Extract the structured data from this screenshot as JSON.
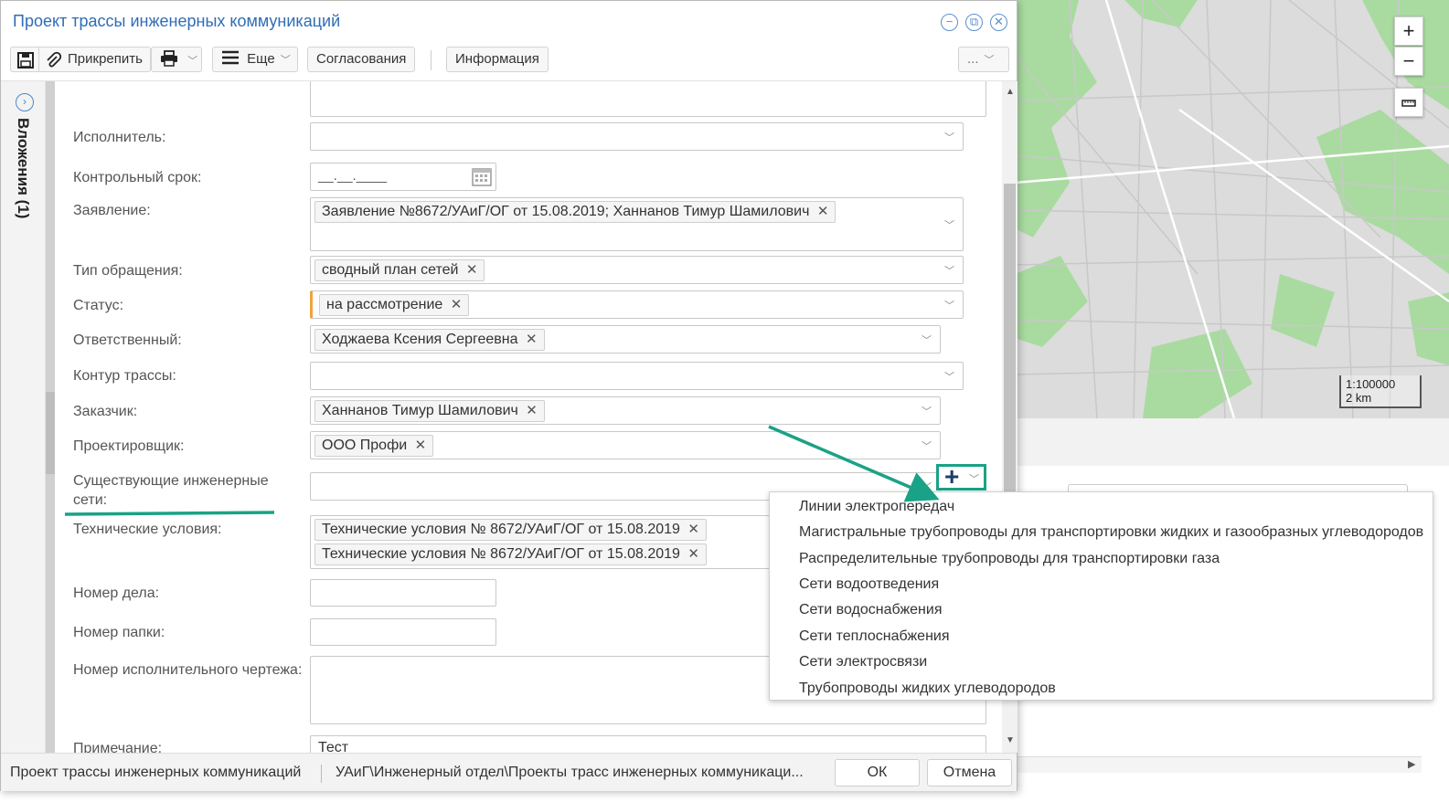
{
  "window": {
    "title": "Проект трассы инженерных коммуникаций"
  },
  "toolbar": {
    "attach_label": "Прикрепить",
    "more_label": "Еще",
    "approvals_label": "Согласования",
    "info_label": "Информация",
    "ellipsis_label": "..."
  },
  "sidebar": {
    "attachments_label": "Вложения (1)"
  },
  "form": {
    "executor": {
      "label": "Исполнитель:"
    },
    "deadline": {
      "label": "Контрольный срок:",
      "placeholder": "__.__.____"
    },
    "statement": {
      "label": "Заявление:",
      "tags": [
        "Заявление №8672/УАиГ/ОГ от 15.08.2019; Ханнанов Тимур Шамилович"
      ]
    },
    "request_type": {
      "label": "Тип обращения:",
      "tags": [
        "сводный план сетей"
      ]
    },
    "status": {
      "label": "Статус:",
      "tags": [
        "на рассмотрение"
      ]
    },
    "responsible": {
      "label": "Ответственный:",
      "tags": [
        "Ходжаева Ксения Сергеевна"
      ]
    },
    "route_contour": {
      "label": "Контур трассы:"
    },
    "customer": {
      "label": "Заказчик:",
      "tags": [
        "Ханнанов Тимур Шамилович"
      ]
    },
    "designer": {
      "label": "Проектировщик:",
      "tags": [
        "ООО Профи"
      ]
    },
    "existing_networks": {
      "label_line1": "Существующие инженерные",
      "label_line2": "сети:"
    },
    "tech_conditions": {
      "label": "Технические условия:",
      "tags": [
        "Технические условия № 8672/УАиГ/ОГ от 15.08.2019",
        "Технические условия № 8672/УАиГ/ОГ от 15.08.2019"
      ]
    },
    "case_number": {
      "label": "Номер дела:"
    },
    "folder_number": {
      "label": "Номер папки:"
    },
    "drawing_number": {
      "label": "Номер исполнительного чертежа:"
    },
    "note": {
      "label": "Примечание:",
      "value": "Тест"
    }
  },
  "dropdown": {
    "items": [
      "Линии электропередач",
      "Магистральные трубопроводы для транспортировки жидких и газообразных углеводородов",
      "Распределительные трубопроводы для транспортировки газа",
      "Сети водоотведения",
      "Сети водоснабжения",
      "Сети теплоснабжения",
      "Сети электросвязи",
      "Трубопроводы жидких углеводородов"
    ]
  },
  "footer": {
    "doc_type": "Проект трассы инженерных коммуникаций",
    "path": "УАиГ\\Инженерный отдел\\Проекты трасс инженерных коммуникаци...",
    "ok_label": "ОК",
    "cancel_label": "Отмена"
  },
  "map": {
    "zoom_in": "+",
    "zoom_out": "−",
    "scale_ratio": "1:100000",
    "scale_distance": "2 km"
  },
  "colors": {
    "title_blue": "#2f6db6",
    "status_accent": "#f0a43a",
    "annotation_teal": "#1aa286",
    "map_green": "#a9dba0"
  },
  "icons": {
    "save": "save-icon",
    "attach": "paperclip-icon",
    "print": "printer-icon",
    "more": "hamburger-icon",
    "calendar": "calendar-icon",
    "add": "plus-icon",
    "minimize": "minimize-icon",
    "restore": "restore-icon",
    "close": "close-icon",
    "ruler": "ruler-icon"
  }
}
